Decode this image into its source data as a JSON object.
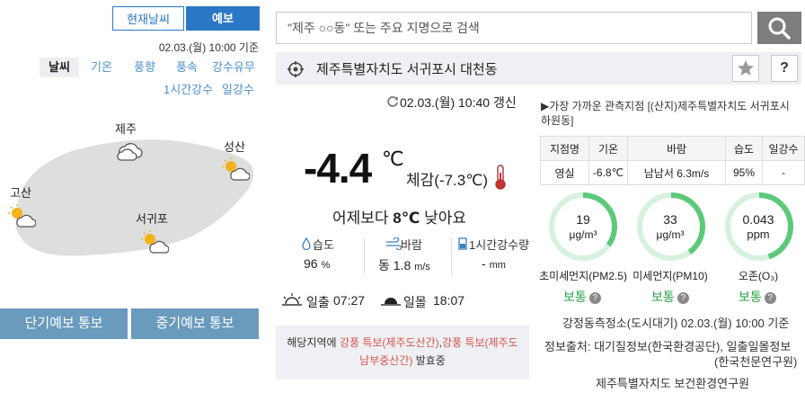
{
  "tabs": {
    "current": "현재날씨",
    "forecast": "예보"
  },
  "base_time": "02.03.(월) 10:00 기준",
  "elements": [
    "날씨",
    "기온",
    "풍향",
    "풍속",
    "강수유무",
    "1시간강수",
    "일강수"
  ],
  "map_cities": [
    "제주",
    "성산",
    "고산",
    "서귀포"
  ],
  "bottom_buttons": {
    "short": "단기예보 통보",
    "mid": "중기예보 통보"
  },
  "search": {
    "placeholder": "\"제주 ○○동\" 또는 주요 지명으로 검색"
  },
  "location": "제주특별자치도 서귀포시 대천동",
  "updated": "02.03.(월) 10:40 갱신",
  "current": {
    "temp": "-4.4",
    "unit": "℃",
    "feels": "체감(-7.3℃)",
    "compare_pre": "어제보다",
    "compare_val": "8℃",
    "compare_post": "낮아요",
    "humidity_label": "습도",
    "humidity_val": "96",
    "humidity_unit": "%",
    "wind_label": "바람",
    "wind_val": "동 1.8",
    "wind_unit": "m/s",
    "rain_label": "1시간강수량",
    "rain_val": "-",
    "rain_unit": "mm",
    "sunrise_label": "일출",
    "sunrise": "07:27",
    "sunset_label": "일몰",
    "sunset": "18:07"
  },
  "warning": {
    "prefix": "해당지역에",
    "hl1": "강풍 특보(제주도산간)",
    "mid": ",강풍 특보(제주도",
    "hl2": "남부중산간)",
    "suffix": "발효중",
    "hl1b": "강풍 특보(제주도",
    "line2_hl": "남부중산간)"
  },
  "observation": {
    "title": "▶가장 가까운 관측지점 [(산지)제주특별자치도 서귀포시 하원동]",
    "headers": [
      "지점명",
      "기온",
      "바람",
      "습도",
      "일강수"
    ],
    "row": [
      "영실",
      "-6.8℃",
      "남남서 6.3m/s",
      "95%",
      "-"
    ]
  },
  "air": [
    {
      "value": "19",
      "unit": "μg/m³",
      "label": "초미세먼지(PM2.5)",
      "grade": "보통",
      "level": 0.35
    },
    {
      "value": "33",
      "unit": "μg/m³",
      "label": "미세먼지(PM10)",
      "grade": "보통",
      "level": 0.4
    },
    {
      "value": "0.043",
      "unit": "ppm",
      "label": "오존(O₃)",
      "grade": "보통",
      "level": 0.45
    }
  ],
  "station": "강정동측정소(도시대기) 02.03.(월) 10:00 기준",
  "source_label": "정보출처:",
  "source_1": "대기질정보(한국환경공단), 일출일몰정보",
  "source_2": "(한국천문연구원)",
  "agency": "제주특별자치도 보건환경연구원",
  "colors": {
    "accent": "#2a78c5",
    "good": "#2aa14a",
    "ring": "#5cc97a",
    "warn": "#d9534f"
  }
}
